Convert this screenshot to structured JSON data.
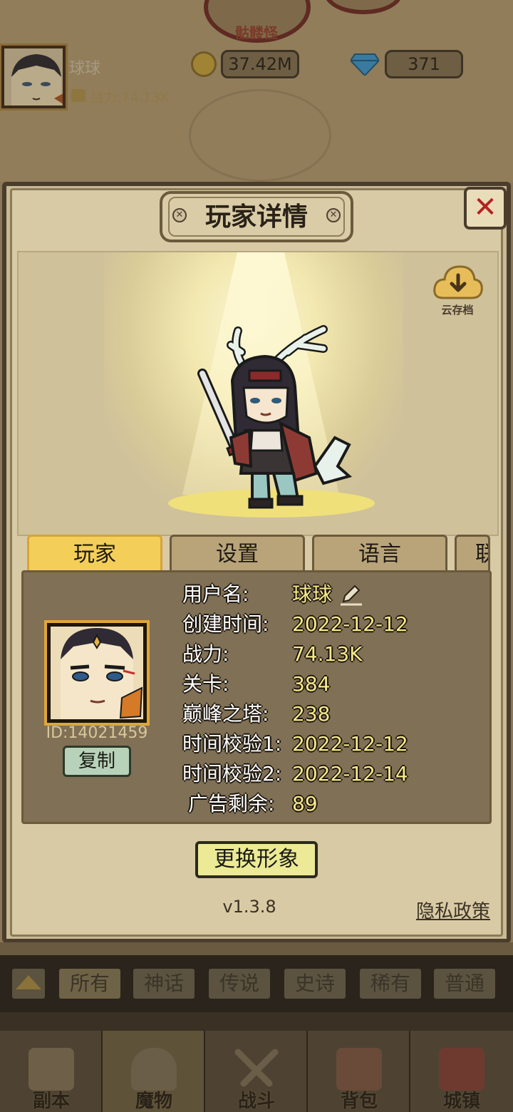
{
  "background": {
    "top_label": "骷髅怪",
    "player_name": "球球",
    "power_label": "战力:74.13K",
    "coins": "37.42M",
    "gems": "371"
  },
  "modal": {
    "title": "玩家详情",
    "close_icon": "close-icon",
    "cloud_label": "云存档",
    "tabs": [
      "玩家",
      "设置",
      "语言",
      "联"
    ],
    "active_tab": "玩家",
    "player_id": "ID:14021459",
    "copy_label": "复制",
    "fields": [
      {
        "label": "用户名:",
        "value": "球球"
      },
      {
        "label": "创建时间:",
        "value": "2022-12-12"
      },
      {
        "label": "战力:",
        "value": "74.13K"
      },
      {
        "label": "关卡:",
        "value": "384"
      },
      {
        "label": "巅峰之塔:",
        "value": "238"
      },
      {
        "label": "时间校验1:",
        "value": "2022-12-12"
      },
      {
        "label": "时间校验2:",
        "value": "2022-12-14"
      },
      {
        "label": "广告剩余:",
        "value": "89"
      }
    ],
    "change_look_label": "更换形象",
    "version": "v1.3.8",
    "privacy_label": "隐私政策"
  },
  "filters": [
    "所有",
    "神话",
    "传说",
    "史诗",
    "稀有",
    "普通"
  ],
  "nav": [
    {
      "label": "副本",
      "icon": "map-icon"
    },
    {
      "label": "魔物",
      "icon": "helmet-icon"
    },
    {
      "label": "战斗",
      "icon": "crossed-swords-icon"
    },
    {
      "label": "背包",
      "icon": "backpack-icon"
    },
    {
      "label": "城镇",
      "icon": "shop-icon"
    }
  ],
  "colors": {
    "active_tab": "#f3cf5a",
    "value_text": "#f6e98a",
    "close_x": "#b32222",
    "modal_bg": "#d8caa4"
  }
}
